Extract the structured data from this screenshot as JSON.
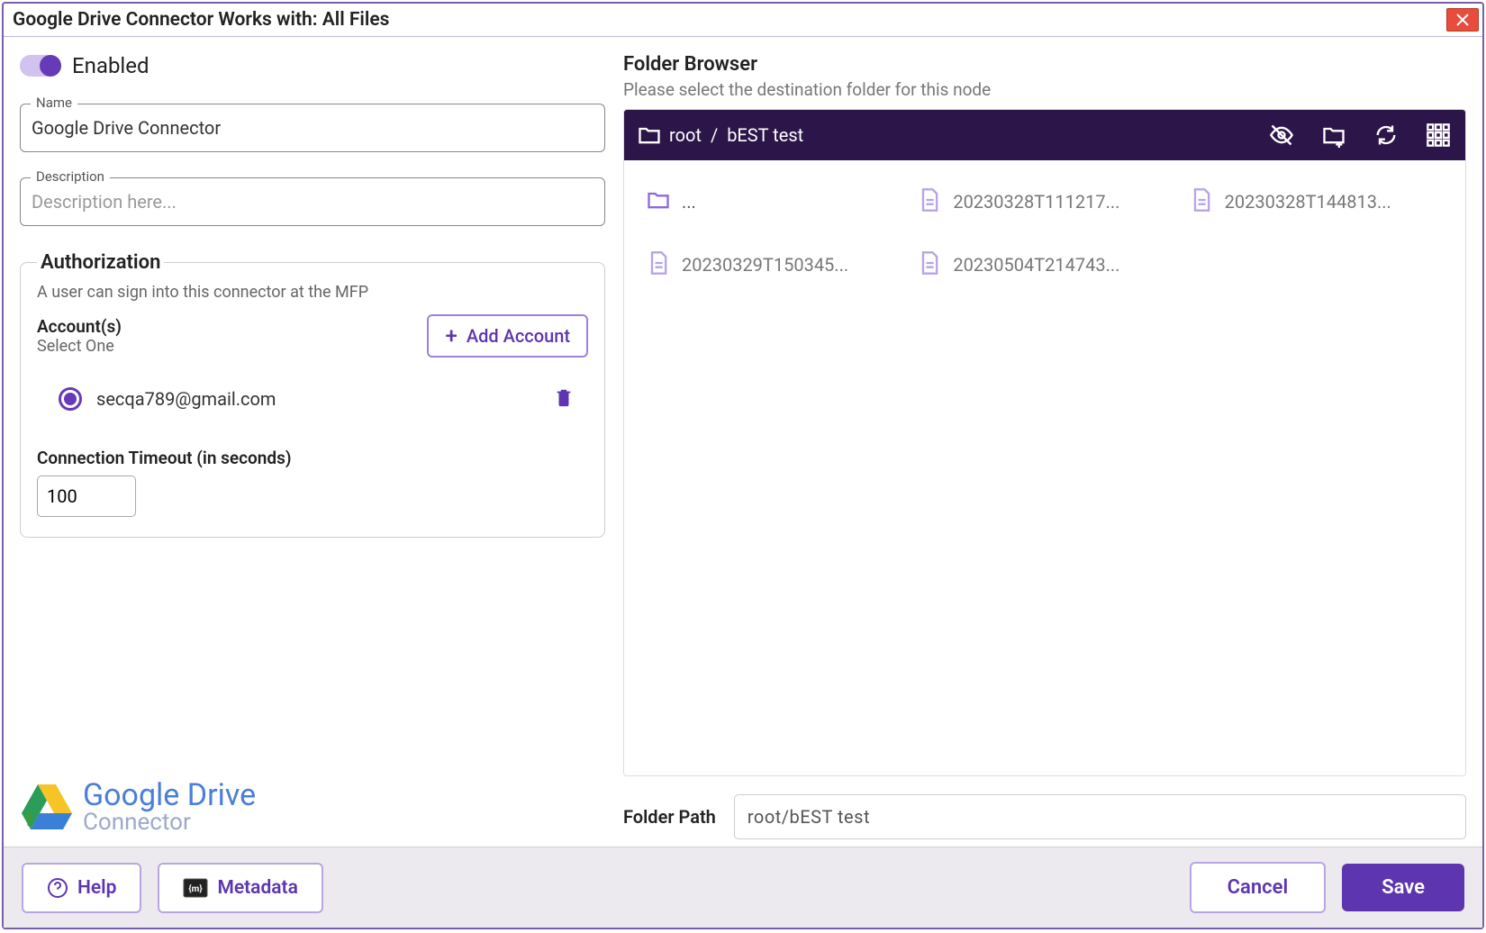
{
  "window": {
    "title": "Google Drive Connector  Works with: All Files"
  },
  "toggle": {
    "label": "Enabled"
  },
  "name_field": {
    "label": "Name",
    "value": "Google Drive Connector"
  },
  "desc_field": {
    "label": "Description",
    "placeholder": "Description here..."
  },
  "auth": {
    "legend": "Authorization",
    "description": "A user can sign into this connector at the MFP",
    "accounts_title": "Account(s)",
    "accounts_sub": "Select One",
    "add_button": "Add Account",
    "accounts": [
      {
        "email": "secqa789@gmail.com",
        "selected": true
      }
    ],
    "timeout_label": "Connection Timeout (in seconds)",
    "timeout_value": "100"
  },
  "logo": {
    "main": "Google Drive",
    "sub": "Connector"
  },
  "folder_browser": {
    "title": "Folder Browser",
    "description": "Please select the destination folder for this node",
    "breadcrumb": [
      "root",
      "bEST test"
    ],
    "items": [
      {
        "name": "...",
        "type": "folder"
      },
      {
        "name": "20230328T111217...",
        "type": "file"
      },
      {
        "name": "20230328T144813...",
        "type": "file"
      },
      {
        "name": "20230329T150345...",
        "type": "file"
      },
      {
        "name": "20230504T214743...",
        "type": "file"
      }
    ]
  },
  "path": {
    "label": "Folder Path",
    "value": "root/bEST test"
  },
  "footer": {
    "help": "Help",
    "metadata": "Metadata",
    "cancel": "Cancel",
    "save": "Save"
  }
}
